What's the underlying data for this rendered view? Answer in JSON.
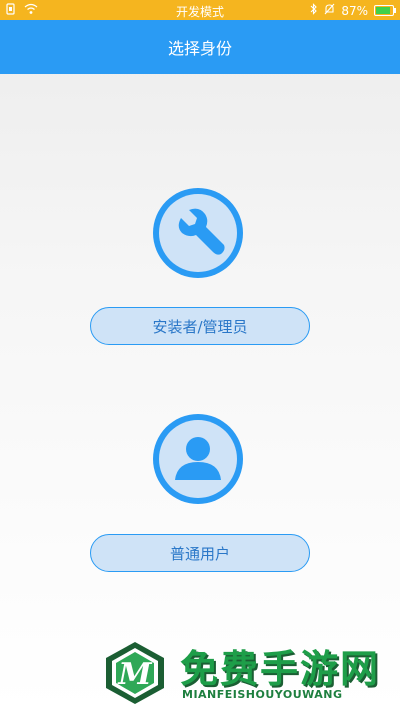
{
  "status_bar": {
    "center_text": "开发模式",
    "battery_text": "87%",
    "battery_level": 0.87
  },
  "header": {
    "title": "选择身份"
  },
  "roles": [
    {
      "icon": "wrench-icon",
      "label": "安装者/管理员"
    },
    {
      "icon": "user-icon",
      "label": "普通用户"
    }
  ],
  "watermark": {
    "title": "免费手游网",
    "subtitle": "MIANFEISHOUYOUWANG",
    "logo_letter": "M"
  }
}
